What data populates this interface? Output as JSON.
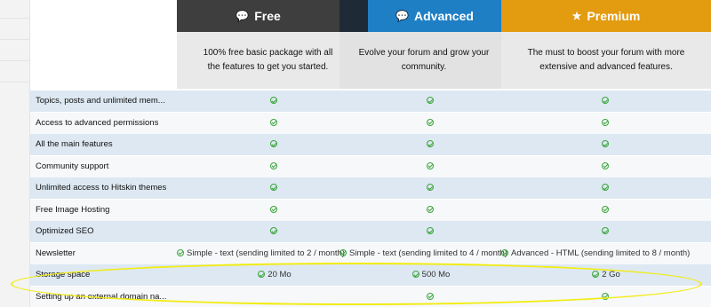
{
  "plans": {
    "free": {
      "name": "Free",
      "icon": "chat-bubble-icon",
      "description": "100% free basic package with all the features to get you started."
    },
    "advanced": {
      "name": "Advanced",
      "icon": "chat-bubbles-icon",
      "description": "Evolve your forum and grow your community."
    },
    "premium": {
      "name": "Premium",
      "icon": "star-icon",
      "description": "The must to boost your forum with more extensive and advanced features."
    }
  },
  "colors": {
    "free": "#3e3e3e",
    "advanced": "#1f7fc5",
    "premium": "#e39b10",
    "check": "#3aa63a",
    "highlight": "#f2ec10"
  },
  "features": [
    {
      "label": "Topics, posts and unlimited mem...",
      "free": true,
      "advanced": true,
      "premium": true
    },
    {
      "label": "Access to advanced permissions",
      "free": true,
      "advanced": true,
      "premium": true
    },
    {
      "label": "All the main features",
      "free": true,
      "advanced": true,
      "premium": true
    },
    {
      "label": "Community support",
      "free": true,
      "advanced": true,
      "premium": true
    },
    {
      "label": "Unlimited access to Hitskin themes",
      "free": true,
      "advanced": true,
      "premium": true
    },
    {
      "label": "Free Image Hosting",
      "free": true,
      "advanced": true,
      "premium": true
    },
    {
      "label": "Optimized SEO",
      "free": true,
      "advanced": true,
      "premium": true
    },
    {
      "label": "Newsletter",
      "free": "Simple - text (sending limited to 2 / month)",
      "advanced": "Simple - text (sending limited to 4 / month)",
      "premium": "Advanced - HTML (sending limited to 8 / month)"
    },
    {
      "label": "Storage space",
      "free": "20 Mo",
      "advanced": "500 Mo",
      "premium": "2 Go"
    },
    {
      "label": "Setting up an external domain na...",
      "free": false,
      "advanced": true,
      "premium": true
    }
  ]
}
